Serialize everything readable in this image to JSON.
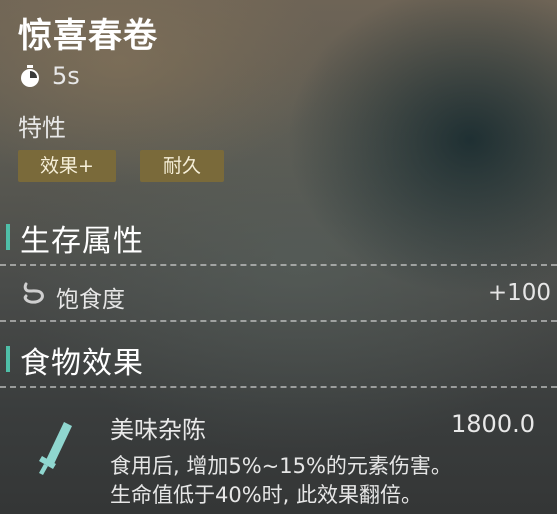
{
  "item": {
    "name": "惊喜春卷",
    "duration": "5s",
    "traits_label": "特性",
    "traits": [
      "效果+",
      "耐久"
    ]
  },
  "survival": {
    "title": "生存属性",
    "stats": [
      {
        "icon": "stomach-icon",
        "label": "饱食度",
        "value": "+100"
      }
    ]
  },
  "food_effects": {
    "title": "食物效果",
    "effects": [
      {
        "icon": "blade-icon",
        "name": "美味杂陈",
        "duration": "1800.0",
        "description_line1": "食用后, 增加5%~15%的元素伤害。",
        "description_line2": "生命值低于40%时, 此效果翻倍。"
      }
    ]
  },
  "colors": {
    "accent": "#4fbfa8",
    "tag_bg": "#7a6a3a",
    "effect_icon": "#8fd6cf"
  }
}
